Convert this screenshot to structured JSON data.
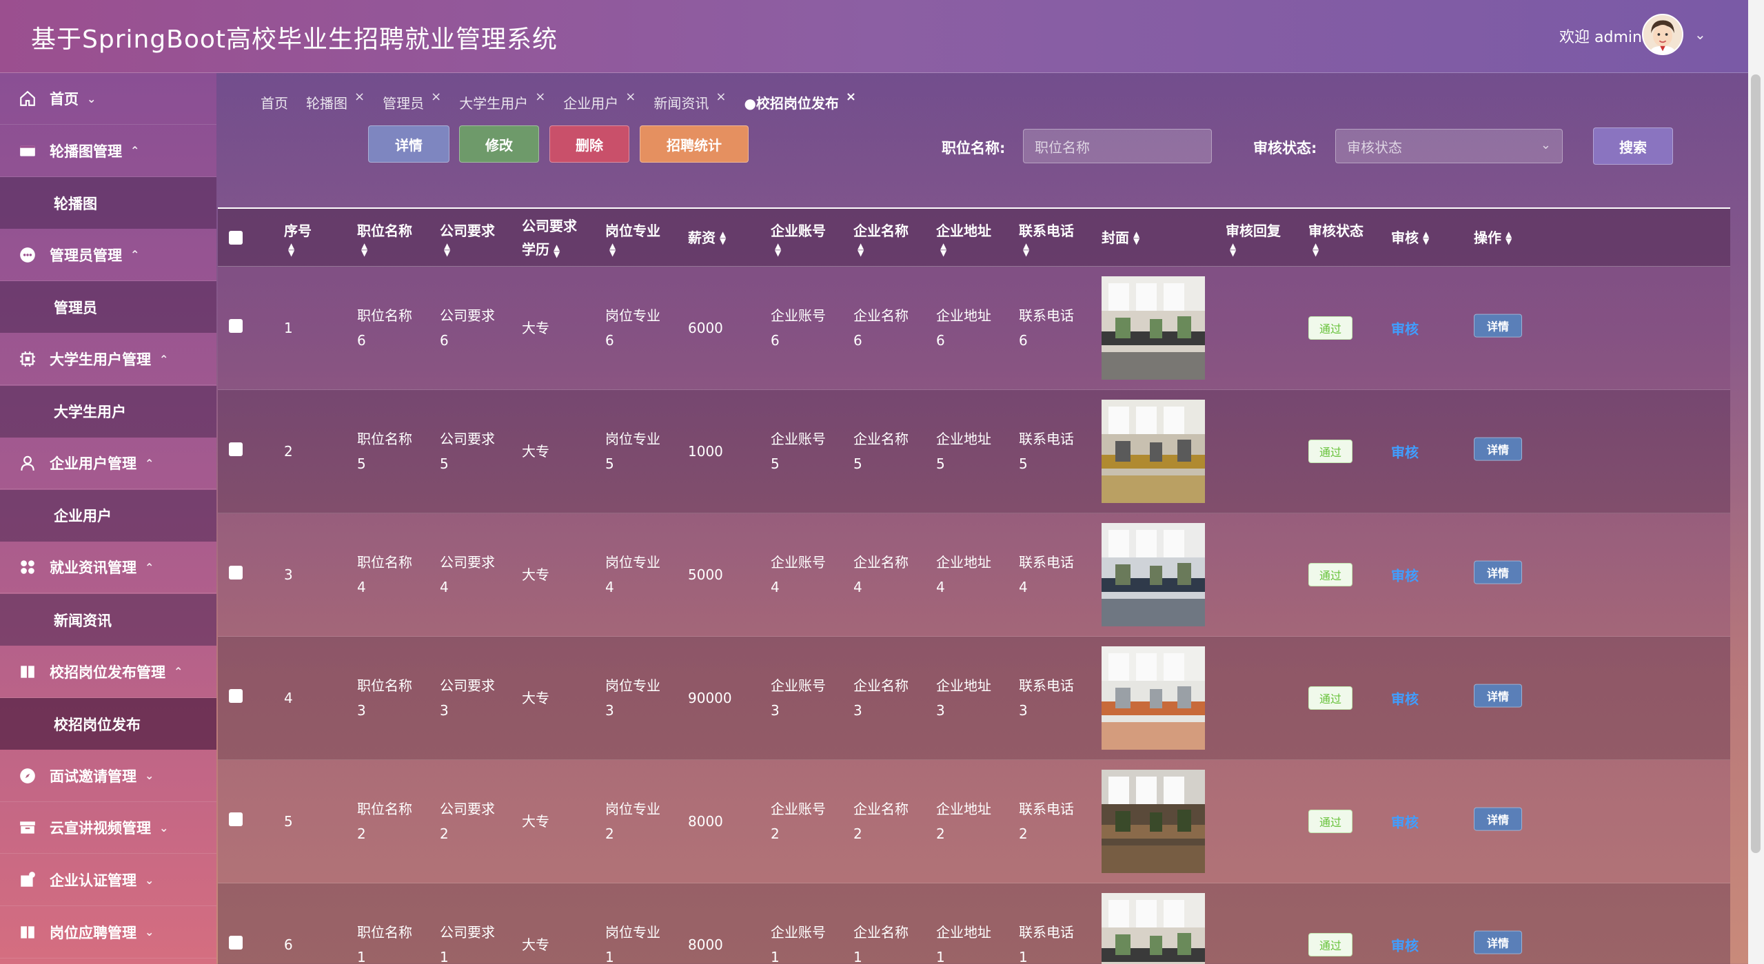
{
  "app": {
    "title": "基于SpringBoot高校毕业生招聘就业管理系统",
    "welcome": "欢迎 admin"
  },
  "sidebar": {
    "items": [
      {
        "label": "首页",
        "arrow": "⌄",
        "icon": "home-icon"
      },
      {
        "label": "轮播图管理",
        "arrow": "⌃",
        "icon": "carousel-icon"
      },
      {
        "label": "轮播图",
        "sub": true
      },
      {
        "label": "管理员管理",
        "arrow": "⌃",
        "icon": "admin-icon"
      },
      {
        "label": "管理员",
        "sub": true
      },
      {
        "label": "大学生用户管理",
        "arrow": "⌃",
        "icon": "chip-icon"
      },
      {
        "label": "大学生用户",
        "sub": true
      },
      {
        "label": "企业用户管理",
        "arrow": "⌃",
        "icon": "user-icon"
      },
      {
        "label": "企业用户",
        "sub": true
      },
      {
        "label": "就业资讯管理",
        "arrow": "⌃",
        "icon": "grid-icon"
      },
      {
        "label": "新闻资讯",
        "sub": true
      },
      {
        "label": "校招岗位发布管理",
        "arrow": "⌃",
        "icon": "book-icon"
      },
      {
        "label": "校招岗位发布",
        "sub": true,
        "active": true
      },
      {
        "label": "面试邀请管理",
        "arrow": "⌄",
        "icon": "compass-icon"
      },
      {
        "label": "云宣讲视频管理",
        "arrow": "⌄",
        "icon": "archive-icon"
      },
      {
        "label": "企业认证管理",
        "arrow": "⌄",
        "icon": "cert-icon"
      },
      {
        "label": "岗位应聘管理",
        "arrow": "⌄",
        "icon": "book-icon"
      }
    ]
  },
  "tabs": [
    {
      "label": "首页",
      "closable": false
    },
    {
      "label": "轮播图",
      "closable": true
    },
    {
      "label": "管理员",
      "closable": true
    },
    {
      "label": "大学生用户",
      "closable": true
    },
    {
      "label": "企业用户",
      "closable": true
    },
    {
      "label": "新闻资讯",
      "closable": true
    },
    {
      "label": "●校招岗位发布",
      "closable": true,
      "active": true
    }
  ],
  "toolbar": {
    "detail": "详情",
    "edit": "修改",
    "delete": "删除",
    "stats": "招聘统计",
    "search": "搜索"
  },
  "filters": {
    "position_label": "职位名称:",
    "position_placeholder": "职位名称",
    "status_label": "审核状态:",
    "status_placeholder": "审核状态"
  },
  "table": {
    "headers": {
      "index": "序号",
      "position": "职位名称",
      "requirement": "公司要求",
      "education_1": "公司要求",
      "education_2": "学历",
      "major": "岗位专业",
      "salary": "薪资",
      "account": "企业账号",
      "company": "企业名称",
      "address": "企业地址",
      "phone": "联系电话",
      "cover": "封面",
      "reply": "审核回复",
      "status": "审核状态",
      "audit": "审核",
      "actions": "操作"
    },
    "rows": [
      {
        "index": "1",
        "position": [
          "职位名称",
          "6"
        ],
        "requirement": [
          "公司要求",
          "6"
        ],
        "education": "大专",
        "major": [
          "岗位专业",
          "6"
        ],
        "salary": "6000",
        "account": [
          "企业账号",
          "6"
        ],
        "company": [
          "企业名称",
          "6"
        ],
        "address": [
          "企业地址",
          "6"
        ],
        "phone": [
          "联系电话",
          "6"
        ],
        "status": "通过",
        "audit": "审核",
        "detail": "详情"
      },
      {
        "index": "2",
        "position": [
          "职位名称",
          "5"
        ],
        "requirement": [
          "公司要求",
          "5"
        ],
        "education": "大专",
        "major": [
          "岗位专业",
          "5"
        ],
        "salary": "1000",
        "account": [
          "企业账号",
          "5"
        ],
        "company": [
          "企业名称",
          "5"
        ],
        "address": [
          "企业地址",
          "5"
        ],
        "phone": [
          "联系电话",
          "5"
        ],
        "status": "通过",
        "audit": "审核",
        "detail": "详情"
      },
      {
        "index": "3",
        "position": [
          "职位名称",
          "4"
        ],
        "requirement": [
          "公司要求",
          "4"
        ],
        "education": "大专",
        "major": [
          "岗位专业",
          "4"
        ],
        "salary": "5000",
        "account": [
          "企业账号",
          "4"
        ],
        "company": [
          "企业名称",
          "4"
        ],
        "address": [
          "企业地址",
          "4"
        ],
        "phone": [
          "联系电话",
          "4"
        ],
        "status": "通过",
        "audit": "审核",
        "detail": "详情"
      },
      {
        "index": "4",
        "position": [
          "职位名称",
          "3"
        ],
        "requirement": [
          "公司要求",
          "3"
        ],
        "education": "大专",
        "major": [
          "岗位专业",
          "3"
        ],
        "salary": "90000",
        "account": [
          "企业账号",
          "3"
        ],
        "company": [
          "企业名称",
          "3"
        ],
        "address": [
          "企业地址",
          "3"
        ],
        "phone": [
          "联系电话",
          "3"
        ],
        "status": "通过",
        "audit": "审核",
        "detail": "详情"
      },
      {
        "index": "5",
        "position": [
          "职位名称",
          "2"
        ],
        "requirement": [
          "公司要求",
          "2"
        ],
        "education": "大专",
        "major": [
          "岗位专业",
          "2"
        ],
        "salary": "8000",
        "account": [
          "企业账号",
          "2"
        ],
        "company": [
          "企业名称",
          "2"
        ],
        "address": [
          "企业地址",
          "2"
        ],
        "phone": [
          "联系电话",
          "2"
        ],
        "status": "通过",
        "audit": "审核",
        "detail": "详情"
      },
      {
        "index": "6",
        "position": [
          "职位名称",
          "1"
        ],
        "requirement": [
          "公司要求",
          "1"
        ],
        "education": "大专",
        "major": [
          "岗位专业",
          "1"
        ],
        "salary": "8000",
        "account": [
          "企业账号",
          "1"
        ],
        "company": [
          "企业名称",
          "1"
        ],
        "address": [
          "企业地址",
          "1"
        ],
        "phone": [
          "联系电话",
          "1"
        ],
        "status": "通过",
        "audit": "审核",
        "detail": "详情"
      }
    ]
  }
}
